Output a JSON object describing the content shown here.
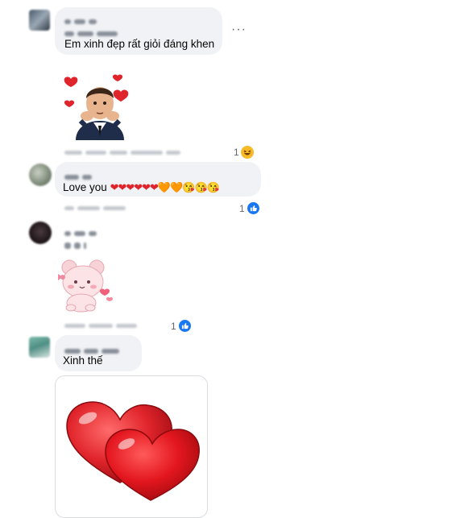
{
  "comments": [
    {
      "text": "Em xinh đẹp rất giỏi đáng khen",
      "reaction_count": "1",
      "reaction_icon": "haha-icon",
      "sticker": "bitmoji-man-with-hearts-sticker"
    },
    {
      "text": "Love you",
      "emojis": "❤❤❤❤❤❤🧡🧡😘😘😘",
      "reaction_count": "1",
      "reaction_icon": "like-icon"
    },
    {
      "sticker": "pink-bear-sticker",
      "reaction_count": "1",
      "reaction_icon": "like-icon"
    },
    {
      "text": "Xinh thế",
      "sticker": "red-hearts-sticker"
    }
  ],
  "menu_glyph": "···",
  "colors": {
    "bubble": "#f0f2f5",
    "like_blue": "#1877f2",
    "heart_red": "#e0242b",
    "meta_gray": "#65676b"
  }
}
